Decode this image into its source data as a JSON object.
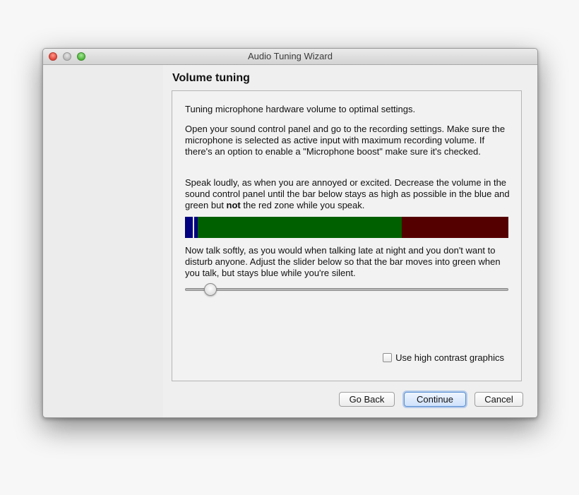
{
  "window": {
    "title": "Audio Tuning Wizard"
  },
  "page": {
    "title": "Volume tuning"
  },
  "text": {
    "intro": "Tuning microphone hardware volume to optimal settings.",
    "instructions": "Open your sound control panel and go to the recording settings. Make sure the microphone is selected as active input with maximum recording volume. If there's an option to enable a \"Microphone boost\" make sure it's checked.",
    "loud_before": "Speak loudly, as when you are annoyed or excited. Decrease the volume in the sound control panel until the bar below stays as high as possible in the blue and green but ",
    "loud_bold": "not",
    "loud_after": " the red zone while you speak.",
    "soft": "Now talk softly, as you would when talking late at night and you don't want to disturb anyone. Adjust the slider below so that the bar moves into green when you talk, but stays blue while you're silent."
  },
  "meter": {
    "zones": {
      "blue_end": 0.04,
      "green_end": 0.67
    },
    "current_level": 0.025,
    "colors": {
      "blue": "#000080",
      "green": "#006000",
      "red": "#550000"
    }
  },
  "slider": {
    "value": 0.062
  },
  "options": {
    "high_contrast_label": "Use high contrast graphics",
    "high_contrast_checked": false
  },
  "buttons": {
    "back": "Go Back",
    "continue": "Continue",
    "cancel": "Cancel"
  }
}
